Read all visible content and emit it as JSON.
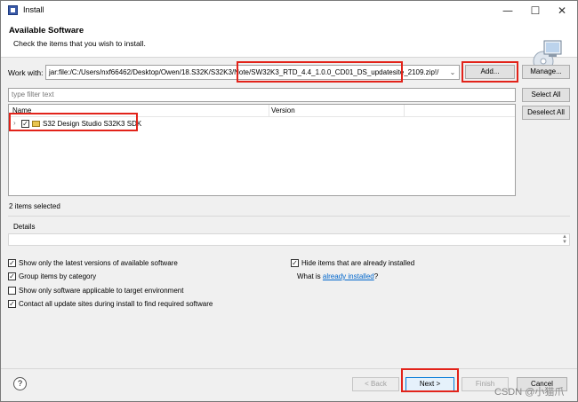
{
  "window": {
    "title": "Install"
  },
  "header": {
    "title": "Available Software",
    "description": "Check the items that you wish to install."
  },
  "work_with": {
    "label": "Work with:",
    "value": "jar:file:/C:/Users/nxf66462/Desktop/Owen/18.S32K/S32K3/Note/SW32K3_RTD_4.4_1.0.0_CD01_DS_updatesite_2109.zip!/",
    "add_label": "Add...",
    "manage_label": "Manage..."
  },
  "filter": {
    "placeholder": "type filter text"
  },
  "buttons": {
    "select_all": "Select All",
    "deselect_all": "Deselect All"
  },
  "tree": {
    "columns": [
      "Name",
      "Version"
    ],
    "rows": [
      {
        "label": "S32 Design Studio S32K3 SDK",
        "checked": true
      }
    ]
  },
  "status": "2 items selected",
  "details": {
    "label": "Details"
  },
  "options": {
    "latest": "Show only the latest versions of available software",
    "group": "Group items by category",
    "applicable": "Show only software applicable to target environment",
    "contact": "Contact all update sites during install to find required software",
    "hide": "Hide items that are already installed",
    "what_is_prefix": "What is ",
    "what_is_link": "already installed",
    "what_is_suffix": "?"
  },
  "footer": {
    "back": "< Back",
    "next": "Next >",
    "finish": "Finish",
    "cancel": "Cancel"
  },
  "watermark": "CSDN @小猫爪",
  "colors": {
    "highlight": "#e2231a",
    "link": "#0066cc",
    "default_button": "#0078d7"
  }
}
